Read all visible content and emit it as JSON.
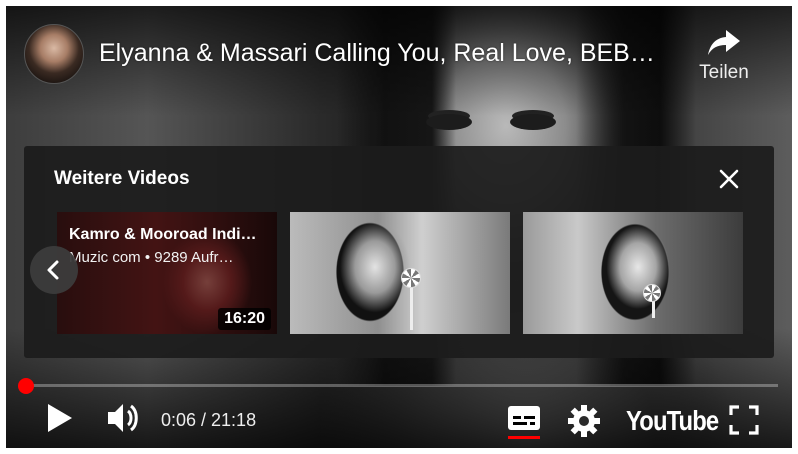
{
  "header": {
    "title": "Elyanna & Massari Calling You, Real Love, BEB…",
    "share_label": "Teilen"
  },
  "more_videos": {
    "heading": "Weitere Videos",
    "items": [
      {
        "title": "Kamro & Mooroad Indi…",
        "meta": "Muzic com • 9289 Aufr…",
        "duration": "16:20"
      },
      {
        "title": "",
        "meta": "",
        "duration": ""
      },
      {
        "title": "",
        "meta": "",
        "duration": ""
      }
    ]
  },
  "controls": {
    "time": "0:06 / 21:18",
    "progress_fraction": 0.005,
    "brand": "YouTube"
  },
  "colors": {
    "accent": "#ff0000",
    "panel": "#1c1c1c",
    "text": "#ffffff"
  },
  "icons": [
    "share-icon",
    "close-icon",
    "chevron-left-icon",
    "play-icon",
    "volume-icon",
    "subtitles-icon",
    "settings-icon",
    "fullscreen-icon"
  ]
}
